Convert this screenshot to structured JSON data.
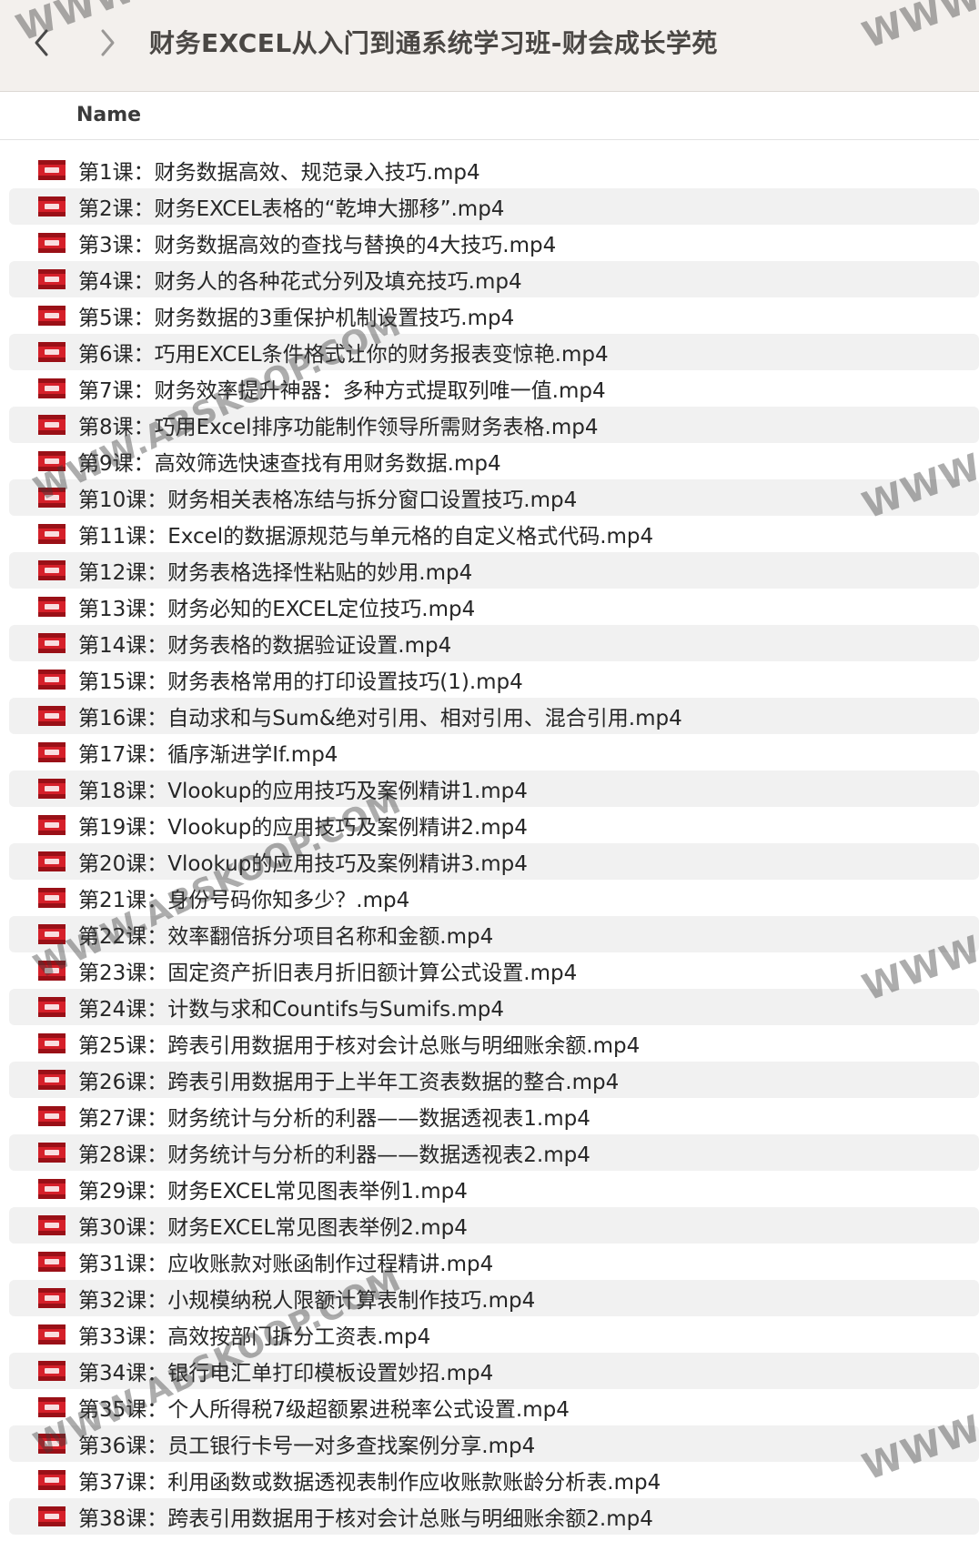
{
  "toolbar": {
    "back_icon": "chevron-left-icon",
    "forward_icon": "chevron-right-icon",
    "title": "财务EXCEL从入门到通系统学习班-财会成长学苑"
  },
  "table": {
    "name_column": "Name"
  },
  "file_icon": "video-file-icon",
  "files": [
    "第1课：财务数据高效、规范录入技巧.mp4",
    "第2课：财务EXCEL表格的“乾坤大挪移”.mp4",
    "第3课：财务数据高效的查找与替换的4大技巧.mp4",
    "第4课：财务人的各种花式分列及填充技巧.mp4",
    "第5课：财务数据的3重保护机制设置技巧.mp4",
    "第6课：巧用EXCEL条件格式让你的财务报表变惊艳.mp4",
    "第7课：财务效率提升神器：多种方式提取列唯一值.mp4",
    "第8课：巧用Excel排序功能制作领导所需财务表格.mp4",
    "第9课：高效筛选快速查找有用财务数据.mp4",
    "第10课：财务相关表格冻结与拆分窗口设置技巧.mp4",
    "第11课：Excel的数据源规范与单元格的自定义格式代码.mp4",
    "第12课：财务表格选择性粘贴的妙用.mp4",
    "第13课：财务必知的EXCEL定位技巧.mp4",
    "第14课：财务表格的数据验证设置.mp4",
    "第15课：财务表格常用的打印设置技巧(1).mp4",
    "第16课：自动求和与Sum&绝对引用、相对引用、混合引用.mp4",
    "第17课：循序渐进学If.mp4",
    "第18课：Vlookup的应用技巧及案例精讲1.mp4",
    "第19课：Vlookup的应用技巧及案例精讲2.mp4",
    "第20课：Vlookup的应用技巧及案例精讲3.mp4",
    "第21课：身份号码你知多少？.mp4",
    "第22课：效率翻倍拆分项目名称和金额.mp4",
    "第23课：固定资产折旧表月折旧额计算公式设置.mp4",
    "第24课：计数与求和Countifs与Sumifs.mp4",
    "第25课：跨表引用数据用于核对会计总账与明细账余额.mp4",
    "第26课：跨表引用数据用于上半年工资表数据的整合.mp4",
    "第27课：财务统计与分析的利器——数据透视表1.mp4",
    "第28课：财务统计与分析的利器——数据透视表2.mp4",
    "第29课：财务EXCEL常见图表举例1.mp4",
    "第30课：财务EXCEL常见图表举例2.mp4",
    "第31课：应收账款对账函制作过程精讲.mp4",
    "第32课：小规模纳税人限额计算表制作技巧.mp4",
    "第33课：高效按部门拆分工资表.mp4",
    "第34课：银行电汇单打印模板设置妙招.mp4",
    "第35课：个人所得税7级超额累进税率公式设置.mp4",
    "第36课：员工银行卡号一对多查找案例分享.mp4",
    "第37课：利用函数或数据透视表制作应收账款账龄分析表.mp4",
    "第38课：跨表引用数据用于核对会计总账与明细账余额2.mp4"
  ],
  "watermarks": {
    "long": "WWW.ABSKOOP.COM",
    "short": "WWW"
  },
  "colors": {
    "toolbar_bg": "#f3f0ed",
    "row_alt": "#f1f1f1",
    "icon_red": "#d6202a"
  }
}
